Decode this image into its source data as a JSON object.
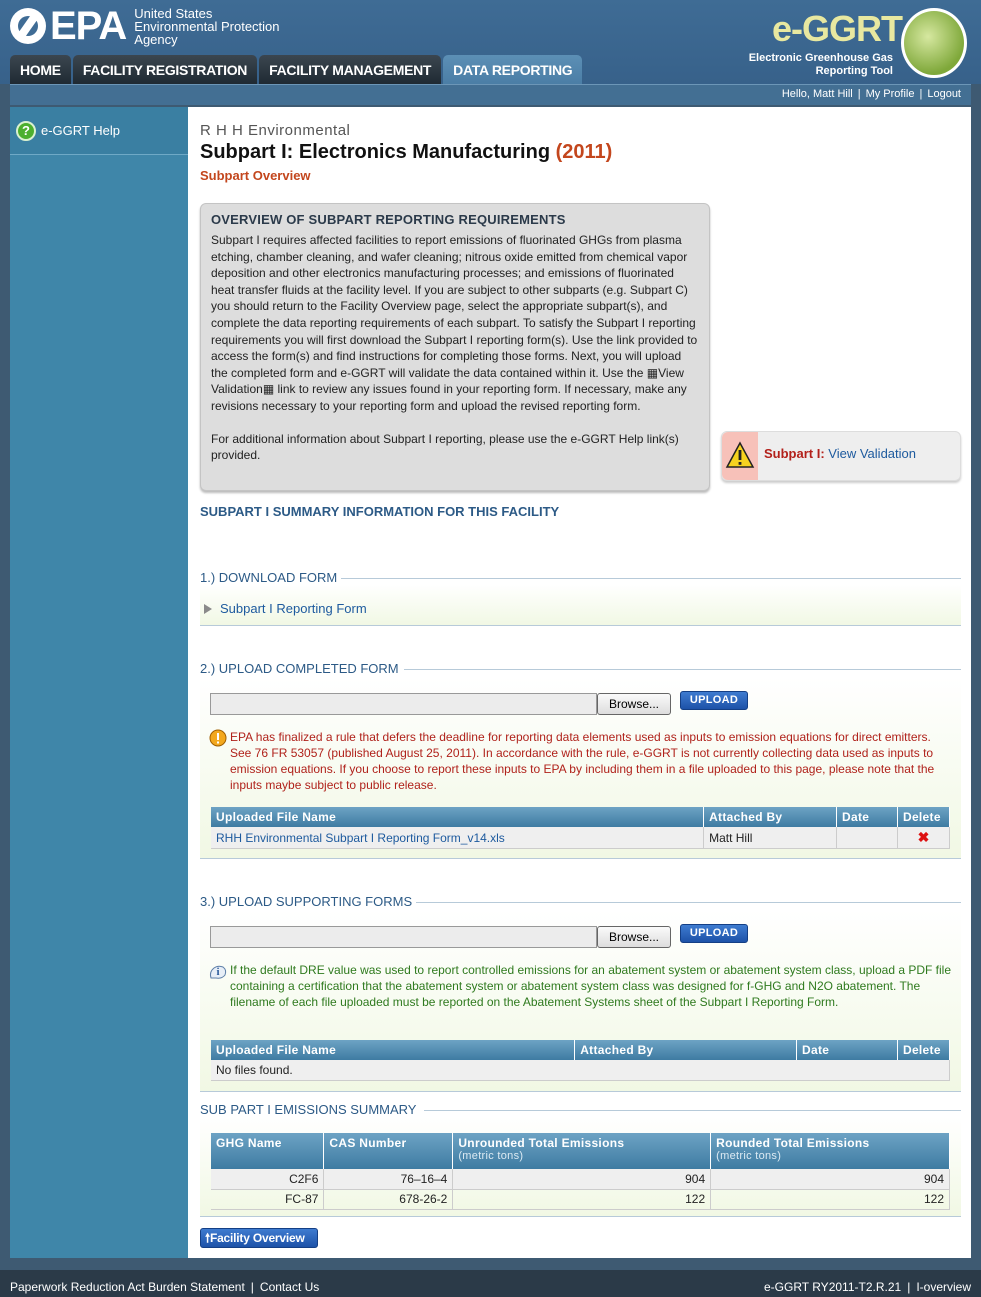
{
  "header": {
    "epa_logo_text": "EPA",
    "agency_lines": [
      "United States",
      "Environmental Protection",
      "Agency"
    ],
    "app_logo_text": "e-GGRT",
    "app_tagline": [
      "Electronic Greenhouse Gas",
      "Reporting Tool"
    ]
  },
  "nav": {
    "tabs": [
      {
        "label": "HOME",
        "active": false
      },
      {
        "label": "FACILITY REGISTRATION",
        "active": false
      },
      {
        "label": "FACILITY MANAGEMENT",
        "active": false
      },
      {
        "label": "DATA REPORTING",
        "active": true
      }
    ]
  },
  "user_bar": {
    "greeting": "Hello, Matt Hill",
    "my_profile": "My Profile",
    "logout": "Logout"
  },
  "sidebar": {
    "help_label": "e-GGRT Help"
  },
  "page": {
    "facility": "R H H Environmental",
    "title": "Subpart I: Electronics Manufacturing",
    "year": "(2011)",
    "subtitle": "Subpart Overview"
  },
  "overview": {
    "heading": "OVERVIEW OF SUBPART REPORTING REQUIREMENTS",
    "paragraph1": "Subpart I requires affected facilities to report emissions of fluorinated GHGs from plasma etching, chamber cleaning, and wafer cleaning; nitrous oxide emitted from chemical vapor deposition and other electronics manufacturing processes; and emissions of fluorinated heat transfer fluids at the facility level. If you are subject to other subparts (e.g. Subpart C) you should return to the Facility Overview page, select the appropriate subpart(s), and complete the data reporting requirements of each subpart. To satisfy the Subpart I reporting requirements you will first download the Subpart I reporting form(s). Use the link provided to access the form(s) and find instructions for completing those forms. Next, you will upload the completed form and e-GGRT will validate the data contained within it. Use the ▦View Validation▦ link to review any issues found in your reporting form. If necessary, make any revisions necessary to your reporting form and upload the revised reporting form.",
    "paragraph2": "For additional information about Subpart I reporting, please use the e-GGRT Help link(s) provided."
  },
  "validation": {
    "label": "Subpart I:",
    "link": "View Validation"
  },
  "summary_heading": "SUBPART I SUMMARY INFORMATION FOR THIS FACILITY",
  "download": {
    "heading": "1.) DOWNLOAD FORM",
    "link": "Subpart I Reporting Form"
  },
  "upload_completed": {
    "heading": "2.) UPLOAD COMPLETED FORM",
    "browse_label": "Browse...",
    "upload_label": "UPLOAD",
    "notice": "EPA has finalized a rule that defers the deadline for reporting data elements used as inputs to emission equations for direct emitters. See 76 FR 53057 (published August 25, 2011). In accordance with the rule, e-GGRT is not currently collecting data used as inputs to emission equations. If you choose to report these inputs to EPA by including them in a file uploaded to this page, please note that the inputs maybe subject to public release.",
    "columns": [
      "Uploaded File Name",
      "Attached By",
      "Date",
      "Delete"
    ],
    "rows": [
      {
        "file": "RHH Environmental Subpart I Reporting Form_v14.xls",
        "attached_by": "Matt Hill",
        "date": ""
      }
    ]
  },
  "upload_supporting": {
    "heading": "3.) UPLOAD SUPPORTING FORMS",
    "browse_label": "Browse...",
    "upload_label": "UPLOAD",
    "notice": "If the default DRE value was used to report controlled emissions for an abatement system or abatement system class, upload a PDF file containing a certification that the abatement system or abatement system class was designed for f-GHG and N2O abatement. The filename of each file uploaded must be reported on the Abatement Systems sheet of the Subpart I Reporting Form.",
    "columns": [
      "Uploaded File Name",
      "Attached By",
      "Date",
      "Delete"
    ],
    "empty_text": "No files found."
  },
  "emissions": {
    "heading": "SUB PART I EMISSIONS SUMMARY",
    "columns": [
      {
        "label": "GHG Name",
        "sub": ""
      },
      {
        "label": "CAS Number",
        "sub": ""
      },
      {
        "label": "Unrounded Total Emissions",
        "sub": "(metric tons)"
      },
      {
        "label": "Rounded Total Emissions",
        "sub": "(metric tons)"
      }
    ],
    "rows": [
      {
        "ghg": "C2F6",
        "cas": "76–16–4",
        "unrounded": "904",
        "rounded": "904"
      },
      {
        "ghg": "FC-87",
        "cas": "678-26-2",
        "unrounded": "122",
        "rounded": "122"
      }
    ]
  },
  "facility_overview_button": "Facility Overview",
  "footer": {
    "burden": "Paperwork Reduction Act Burden Statement",
    "contact": "Contact Us",
    "version": "e-GGRT RY2011-T2.R.21",
    "page_id": "I-overview"
  },
  "colors": {
    "header_blue": "#3f6c95",
    "sidebar_blue": "#3f86a9",
    "title_accent": "#c3461d",
    "link_blue": "#1d5a9e",
    "notice_red": "#b0221b",
    "notice_green": "#2f7a1e"
  }
}
